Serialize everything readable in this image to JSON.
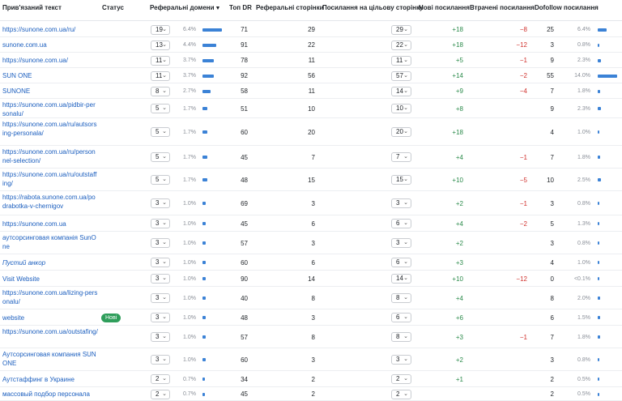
{
  "columns": {
    "anchor": "Прив'язаний текст",
    "status": "Статус",
    "ref_domains": "Реферальні домени",
    "dr": "Топ DR",
    "ref_pages": "Реферальні сторінки",
    "links_to_target": "Посилання на цільову сторінку",
    "new_links": "Нові посилання",
    "lost_links": "Втрачені посилання",
    "dofollow": "Dofollow посилання"
  },
  "sort_icon": "caret-down-icon",
  "accent_color": "#3b82d6",
  "rows": [
    {
      "anchor": "https://sunone.com.ua/ru/",
      "status": "",
      "domains": "19",
      "domains_pct": "6.4%",
      "domains_frac": 0.345,
      "dr": "71",
      "ref_pages": "29",
      "links": "29",
      "new": "+18",
      "lost": "−8",
      "dofollow": "25",
      "dofollow_pct": "6.4%",
      "dofollow_frac": 0.455
    },
    {
      "anchor": "sunone.com.ua",
      "status": "",
      "domains": "13",
      "domains_pct": "4.4%",
      "domains_frac": 0.236,
      "dr": "91",
      "ref_pages": "22",
      "links": "22",
      "new": "+18",
      "lost": "−12",
      "dofollow": "3",
      "dofollow_pct": "0.8%",
      "dofollow_frac": 0.055
    },
    {
      "anchor": "https://sunone.com.ua/",
      "status": "",
      "domains": "11",
      "domains_pct": "3.7%",
      "domains_frac": 0.2,
      "dr": "78",
      "ref_pages": "11",
      "links": "11",
      "new": "+5",
      "lost": "−1",
      "dofollow": "9",
      "dofollow_pct": "2.3%",
      "dofollow_frac": 0.164
    },
    {
      "anchor": "SUN ONE",
      "status": "",
      "domains": "11",
      "domains_pct": "3.7%",
      "domains_frac": 0.2,
      "dr": "92",
      "ref_pages": "56",
      "links": "57",
      "new": "+14",
      "lost": "−2",
      "dofollow": "55",
      "dofollow_pct": "14.0%",
      "dofollow_frac": 1.0
    },
    {
      "anchor": "SUNONE",
      "status": "",
      "domains": "8",
      "domains_pct": "2.7%",
      "domains_frac": 0.145,
      "dr": "58",
      "ref_pages": "11",
      "links": "14",
      "new": "+9",
      "lost": "−4",
      "dofollow": "7",
      "dofollow_pct": "1.8%",
      "dofollow_frac": 0.127
    },
    {
      "anchor": "https://sunone.com.ua/pidbir-personalu/",
      "status": "",
      "domains": "5",
      "domains_pct": "1.7%",
      "domains_frac": 0.091,
      "dr": "51",
      "ref_pages": "10",
      "links": "10",
      "new": "+8",
      "lost": "",
      "dofollow": "9",
      "dofollow_pct": "2.3%",
      "dofollow_frac": 0.164
    },
    {
      "anchor": "https://sunone.com.ua/ru/autsorsing-personala/",
      "status": "",
      "domains": "5",
      "domains_pct": "1.7%",
      "domains_frac": 0.091,
      "dr": "60",
      "ref_pages": "20",
      "links": "20",
      "new": "+18",
      "lost": "",
      "dofollow": "4",
      "dofollow_pct": "1.0%",
      "dofollow_frac": 0.073
    },
    {
      "anchor": "https://sunone.com.ua/ru/personnel-selection/",
      "status": "",
      "domains": "5",
      "domains_pct": "1.7%",
      "domains_frac": 0.091,
      "dr": "45",
      "ref_pages": "7",
      "links": "7",
      "new": "+4",
      "lost": "−1",
      "dofollow": "7",
      "dofollow_pct": "1.8%",
      "dofollow_frac": 0.127
    },
    {
      "anchor": "https://sunone.com.ua/ru/outstaffing/",
      "status": "",
      "domains": "5",
      "domains_pct": "1.7%",
      "domains_frac": 0.091,
      "dr": "48",
      "ref_pages": "15",
      "links": "15",
      "new": "+10",
      "lost": "−5",
      "dofollow": "10",
      "dofollow_pct": "2.5%",
      "dofollow_frac": 0.182
    },
    {
      "anchor": "https://rabota.sunone.com.ua/podrabotka-v-chernigov",
      "status": "",
      "domains": "3",
      "domains_pct": "1.0%",
      "domains_frac": 0.055,
      "dr": "69",
      "ref_pages": "3",
      "links": "3",
      "new": "+2",
      "lost": "−1",
      "dofollow": "3",
      "dofollow_pct": "0.8%",
      "dofollow_frac": 0.055
    },
    {
      "anchor": "https://sunone.com.ua",
      "status": "",
      "domains": "3",
      "domains_pct": "1.0%",
      "domains_frac": 0.055,
      "dr": "45",
      "ref_pages": "6",
      "links": "6",
      "new": "+4",
      "lost": "−2",
      "dofollow": "5",
      "dofollow_pct": "1.3%",
      "dofollow_frac": 0.091
    },
    {
      "anchor": "аутсорсинговая компанія SunOne",
      "status": "",
      "domains": "3",
      "domains_pct": "1.0%",
      "domains_frac": 0.055,
      "dr": "57",
      "ref_pages": "3",
      "links": "3",
      "new": "+2",
      "lost": "",
      "dofollow": "3",
      "dofollow_pct": "0.8%",
      "dofollow_frac": 0.055
    },
    {
      "anchor": "Пустий анкор",
      "italic": true,
      "status": "",
      "domains": "3",
      "domains_pct": "1.0%",
      "domains_frac": 0.055,
      "dr": "60",
      "ref_pages": "6",
      "links": "6",
      "new": "+3",
      "lost": "",
      "dofollow": "4",
      "dofollow_pct": "1.0%",
      "dofollow_frac": 0.073
    },
    {
      "anchor": "Visit Website",
      "status": "",
      "domains": "3",
      "domains_pct": "1.0%",
      "domains_frac": 0.055,
      "dr": "90",
      "ref_pages": "14",
      "links": "14",
      "new": "+10",
      "lost": "−12",
      "dofollow": "0",
      "dofollow_pct": "<0.1%",
      "dofollow_frac": 0.0
    },
    {
      "anchor": "https://sunone.com.ua/lizing-personalu/",
      "status": "",
      "domains": "3",
      "domains_pct": "1.0%",
      "domains_frac": 0.055,
      "dr": "40",
      "ref_pages": "8",
      "links": "8",
      "new": "+4",
      "lost": "",
      "dofollow": "8",
      "dofollow_pct": "2.0%",
      "dofollow_frac": 0.145
    },
    {
      "anchor": "website",
      "status": "Нові",
      "domains": "3",
      "domains_pct": "1.0%",
      "domains_frac": 0.055,
      "dr": "48",
      "ref_pages": "3",
      "links": "6",
      "new": "+6",
      "lost": "",
      "dofollow": "6",
      "dofollow_pct": "1.5%",
      "dofollow_frac": 0.109
    },
    {
      "anchor": "https://sunone.com.ua/outstafing/",
      "status": "",
      "domains": "3",
      "domains_pct": "1.0%",
      "domains_frac": 0.055,
      "dr": "57",
      "ref_pages": "8",
      "links": "8",
      "new": "+3",
      "lost": "−1",
      "dofollow": "7",
      "dofollow_pct": "1.8%",
      "dofollow_frac": 0.127
    },
    {
      "anchor": "Аутсорсинговая компания SUNONE",
      "status": "",
      "domains": "3",
      "domains_pct": "1.0%",
      "domains_frac": 0.055,
      "dr": "60",
      "ref_pages": "3",
      "links": "3",
      "new": "+2",
      "lost": "",
      "dofollow": "3",
      "dofollow_pct": "0.8%",
      "dofollow_frac": 0.055
    },
    {
      "anchor": "Аутстаффинг в Украине",
      "status": "",
      "domains": "2",
      "domains_pct": "0.7%",
      "domains_frac": 0.036,
      "dr": "34",
      "ref_pages": "2",
      "links": "2",
      "new": "+1",
      "lost": "",
      "dofollow": "2",
      "dofollow_pct": "0.5%",
      "dofollow_frac": 0.036
    },
    {
      "anchor": "массовый подбор персонала",
      "status": "",
      "domains": "2",
      "domains_pct": "0.7%",
      "domains_frac": 0.036,
      "dr": "45",
      "ref_pages": "2",
      "links": "2",
      "new": "",
      "lost": "",
      "dofollow": "2",
      "dofollow_pct": "0.5%",
      "dofollow_frac": 0.036
    }
  ]
}
